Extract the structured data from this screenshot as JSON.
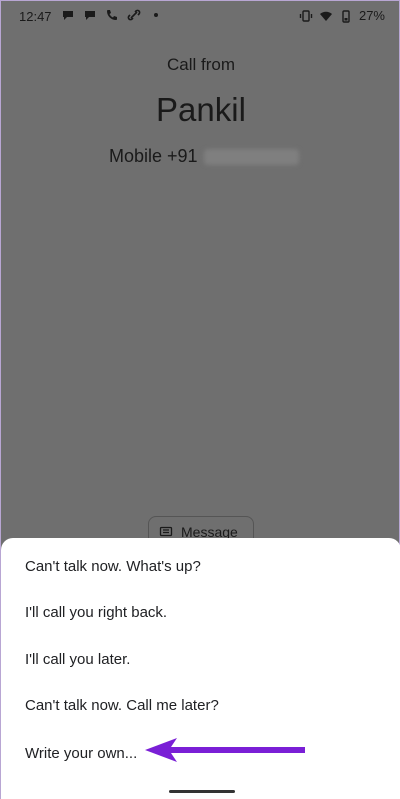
{
  "status": {
    "time": "12:47",
    "battery": "27%"
  },
  "call": {
    "header": "Call from",
    "name": "Pankil",
    "number_prefix": "Mobile +91"
  },
  "message_button": {
    "label": "Message"
  },
  "replies": [
    "Can't talk now. What's up?",
    "I'll call you right back.",
    "I'll call you later.",
    "Can't talk now. Call me later?",
    "Write your own..."
  ],
  "colors": {
    "overlay": "#6f6f6f",
    "sheet": "#ffffff",
    "arrow": "#7a1fd6"
  }
}
